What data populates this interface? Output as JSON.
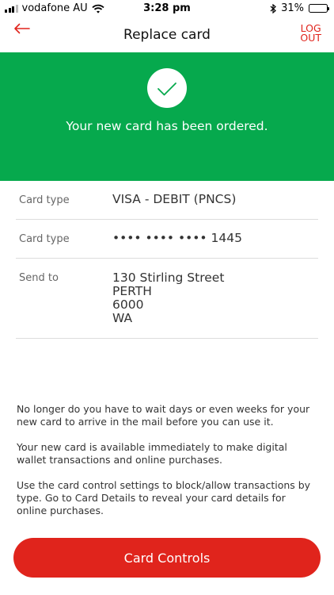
{
  "status_bar": {
    "carrier": "vodafone AU",
    "time": "3:28 pm",
    "battery_percent": "31%",
    "battery_level": 0.31,
    "icons": [
      "signal-icon",
      "wifi-icon",
      "bluetooth-icon",
      "battery-icon"
    ]
  },
  "nav": {
    "back_icon": "arrow-left-icon",
    "title": "Replace card",
    "logout_label_line1": "LOG",
    "logout_label_line2": "OUT"
  },
  "banner": {
    "icon": "checkmark-icon",
    "message": "Your new card has been ordered."
  },
  "details": [
    {
      "label": "Card type",
      "value": "VISA - DEBIT (PNCS)"
    },
    {
      "label": "Card type",
      "value": "•••• •••• •••• 1445"
    },
    {
      "label": "Send to",
      "value": "130 Stirling Street\nPERTH\n6000\nWA"
    }
  ],
  "info_paragraphs": [
    "No longer do you have to wait days or even weeks for your new card to arrive in the mail before you can use it.",
    "Your new card is available immediately to make digital wallet transactions and online purchases.",
    "Use the card control settings to block/allow transactions by type. Go to Card Details to reveal your card details for online purchases."
  ],
  "primary_action": {
    "label": "Card Controls"
  },
  "colors": {
    "brand_red": "#e0241c",
    "success_green": "#06a94d",
    "divider": "#dddddd"
  }
}
